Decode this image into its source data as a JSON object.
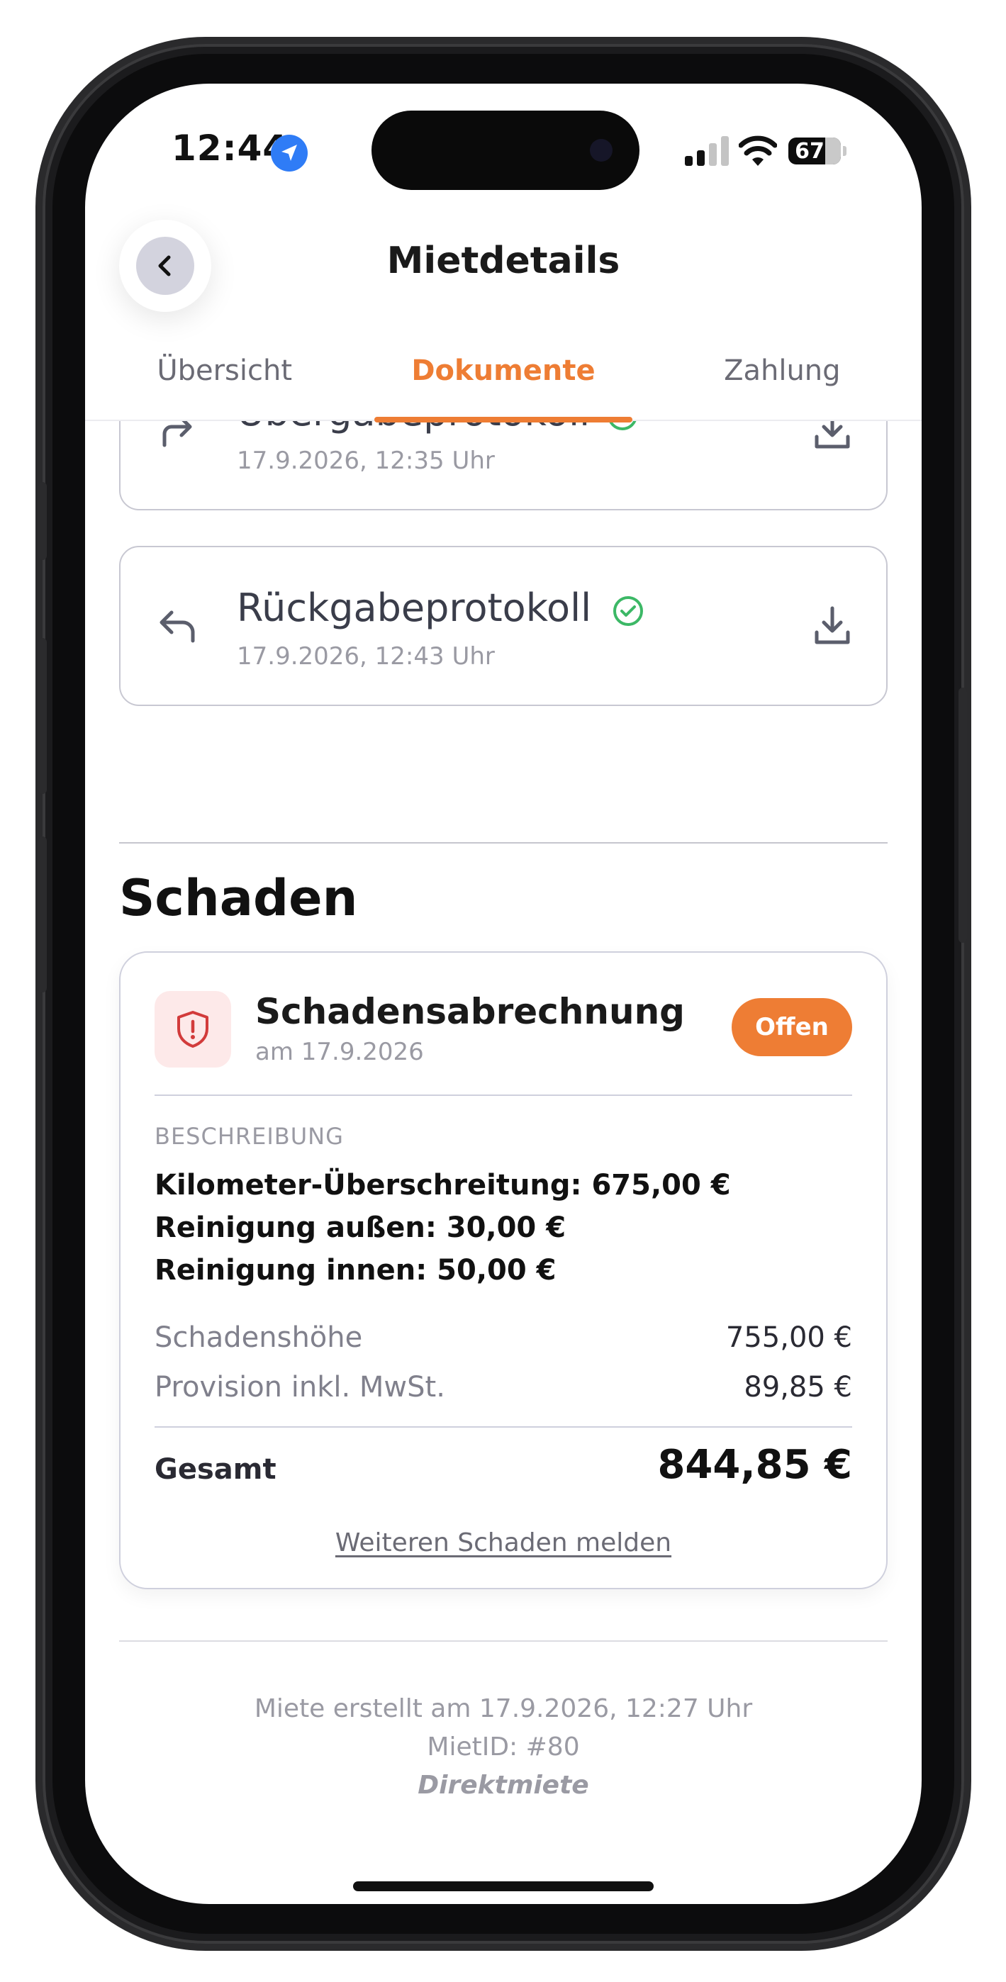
{
  "status_bar": {
    "time": "12:44",
    "battery": "67"
  },
  "header": {
    "title": "Mietdetails"
  },
  "tabs": [
    {
      "label": "Übersicht",
      "active": false
    },
    {
      "label": "Dokumente",
      "active": true
    },
    {
      "label": "Zahlung",
      "active": false
    }
  ],
  "documents": [
    {
      "title": "Übergabeprotokoll",
      "date": "17.9.2026, 12:35 Uhr",
      "verified": true
    },
    {
      "title": "Rückgabeprotokoll",
      "date": "17.9.2026, 12:43 Uhr",
      "verified": true
    }
  ],
  "damage_section": {
    "title": "Schaden",
    "card": {
      "title": "Schadensabrechnung",
      "date": "am 17.9.2026",
      "status": "Offen",
      "description_label": "BESCHREIBUNG",
      "description_lines": [
        "Kilometer-Überschreitung: 675,00 €",
        "Reinigung außen: 30,00 €",
        "Reinigung innen: 50,00 €"
      ],
      "damage_amount_label": "Schadenshöhe",
      "damage_amount": "755,00 €",
      "commission_label": "Provision inkl. MwSt.",
      "commission_amount": "89,85 €",
      "total_label": "Gesamt",
      "total_amount": "844,85 €",
      "report_link": "Weiteren Schaden melden"
    }
  },
  "footer": {
    "created": "Miete erstellt am 17.9.2026, 12:27 Uhr",
    "rent_id": "MietID: #80",
    "type": "Direktmiete"
  },
  "colors": {
    "accent": "#ee7d34",
    "verified": "#3cb866",
    "danger": "#d23b3b"
  }
}
